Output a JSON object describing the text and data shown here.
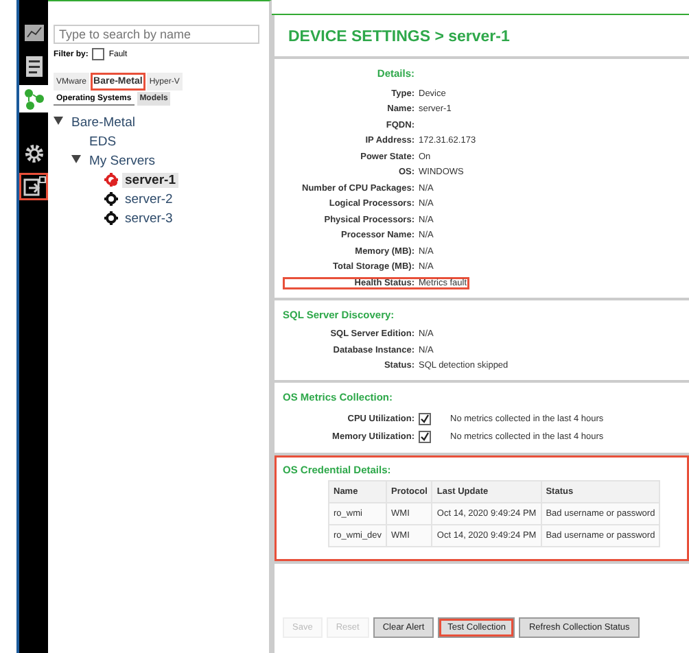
{
  "rail": [
    {
      "kind": "chart",
      "selected": false,
      "highlighted": false
    },
    {
      "kind": "clipboard",
      "selected": false,
      "highlighted": false
    },
    {
      "kind": "nodes",
      "selected": true,
      "highlighted": false
    },
    {
      "kind": "gear",
      "selected": false,
      "highlighted": false
    },
    {
      "kind": "exit",
      "selected": false,
      "highlighted": true
    }
  ],
  "search": {
    "placeholder": "Type to search by name"
  },
  "filter": {
    "label": "Filter by:",
    "option": "Fault",
    "checked": false
  },
  "tabs": [
    {
      "label": "VMware",
      "selected": false,
      "highlighted": false
    },
    {
      "label": "Bare-Metal",
      "selected": true,
      "highlighted": true
    },
    {
      "label": "Hyper-V",
      "selected": false,
      "highlighted": false
    }
  ],
  "subtabs": [
    {
      "label": "Operating Systems",
      "selected": true
    },
    {
      "label": "Models",
      "selected": false
    }
  ],
  "tree": [
    {
      "label": "Bare-Metal",
      "expanded": true,
      "children": [
        {
          "label": "EDS"
        },
        {
          "label": "My Servers",
          "expanded": true,
          "children": [
            {
              "label": "server-1",
              "fault": true,
              "selected": true
            },
            {
              "label": "server-2",
              "fault": false,
              "selected": false
            },
            {
              "label": "server-3",
              "fault": false,
              "selected": false
            }
          ]
        }
      ]
    }
  ],
  "title": "DEVICE SETTINGS > server-1",
  "sections": [
    {
      "title": "Details:",
      "highlighted": false,
      "fields": [
        {
          "label": "Type:",
          "value": "Device",
          "highlighted": false
        },
        {
          "label": "Name:",
          "value": "server-1",
          "highlighted": false
        },
        {
          "label": "FQDN:",
          "highlighted": false
        },
        {
          "label": "IP Address:",
          "value": "172.31.62.173",
          "highlighted": false
        },
        {
          "label": "Power State:",
          "value": "On",
          "highlighted": false
        },
        {
          "label": "OS:",
          "value": "WINDOWS",
          "highlighted": false
        },
        {
          "label": "Number of CPU Packages:",
          "value": "N/A",
          "highlighted": false
        },
        {
          "label": "Logical Processors:",
          "value": "N/A",
          "highlighted": false
        },
        {
          "label": "Physical Processors:",
          "value": "N/A",
          "highlighted": false
        },
        {
          "label": "Processor Name:",
          "value": "N/A",
          "highlighted": false
        },
        {
          "label": "Memory (MB):",
          "value": "N/A",
          "highlighted": false
        },
        {
          "label": "Total Storage (MB):",
          "value": "N/A",
          "highlighted": false
        },
        {
          "label": "Health Status:",
          "value": "Metrics fault",
          "highlighted": true
        }
      ]
    },
    {
      "title": "SQL Server Discovery:",
      "highlighted": false,
      "fields": [
        {
          "label": "SQL Server Edition:",
          "value": "N/A",
          "highlighted": false
        },
        {
          "label": "Database Instance:",
          "value": "N/A",
          "highlighted": false
        },
        {
          "label": "Status:",
          "value": "SQL detection skipped",
          "highlighted": false
        }
      ]
    },
    {
      "title": "OS Metrics Collection:",
      "highlighted": false,
      "fields": [
        {
          "label": "CPU Utilization:",
          "checked": true,
          "value": "No metrics collected in the last 4 hours",
          "highlighted": false
        },
        {
          "label": "Memory Utilization:",
          "checked": true,
          "value": "No metrics collected in the last 4 hours",
          "highlighted": false
        }
      ]
    },
    {
      "title": "OS Credential Details:",
      "highlighted": true,
      "table": {
        "columns": [
          "Name",
          "Protocol",
          "Last Update",
          "Status"
        ],
        "rows": [
          [
            "ro_wmi",
            "WMI",
            "Oct 14, 2020 9:49:24 PM",
            "Bad username or password"
          ],
          [
            "ro_wmi_dev",
            "WMI",
            "Oct 14, 2020 9:49:24 PM",
            "Bad username or password"
          ]
        ]
      }
    }
  ],
  "buttons": [
    {
      "label": "Save",
      "disabled": true,
      "highlighted": false
    },
    {
      "label": "Reset",
      "disabled": true,
      "highlighted": false
    },
    {
      "label": "Clear Alert",
      "disabled": false,
      "highlighted": false
    },
    {
      "label": "Test Collection",
      "disabled": false,
      "highlighted": true
    },
    {
      "label": "Refresh Collection Status",
      "disabled": false,
      "highlighted": false
    }
  ]
}
